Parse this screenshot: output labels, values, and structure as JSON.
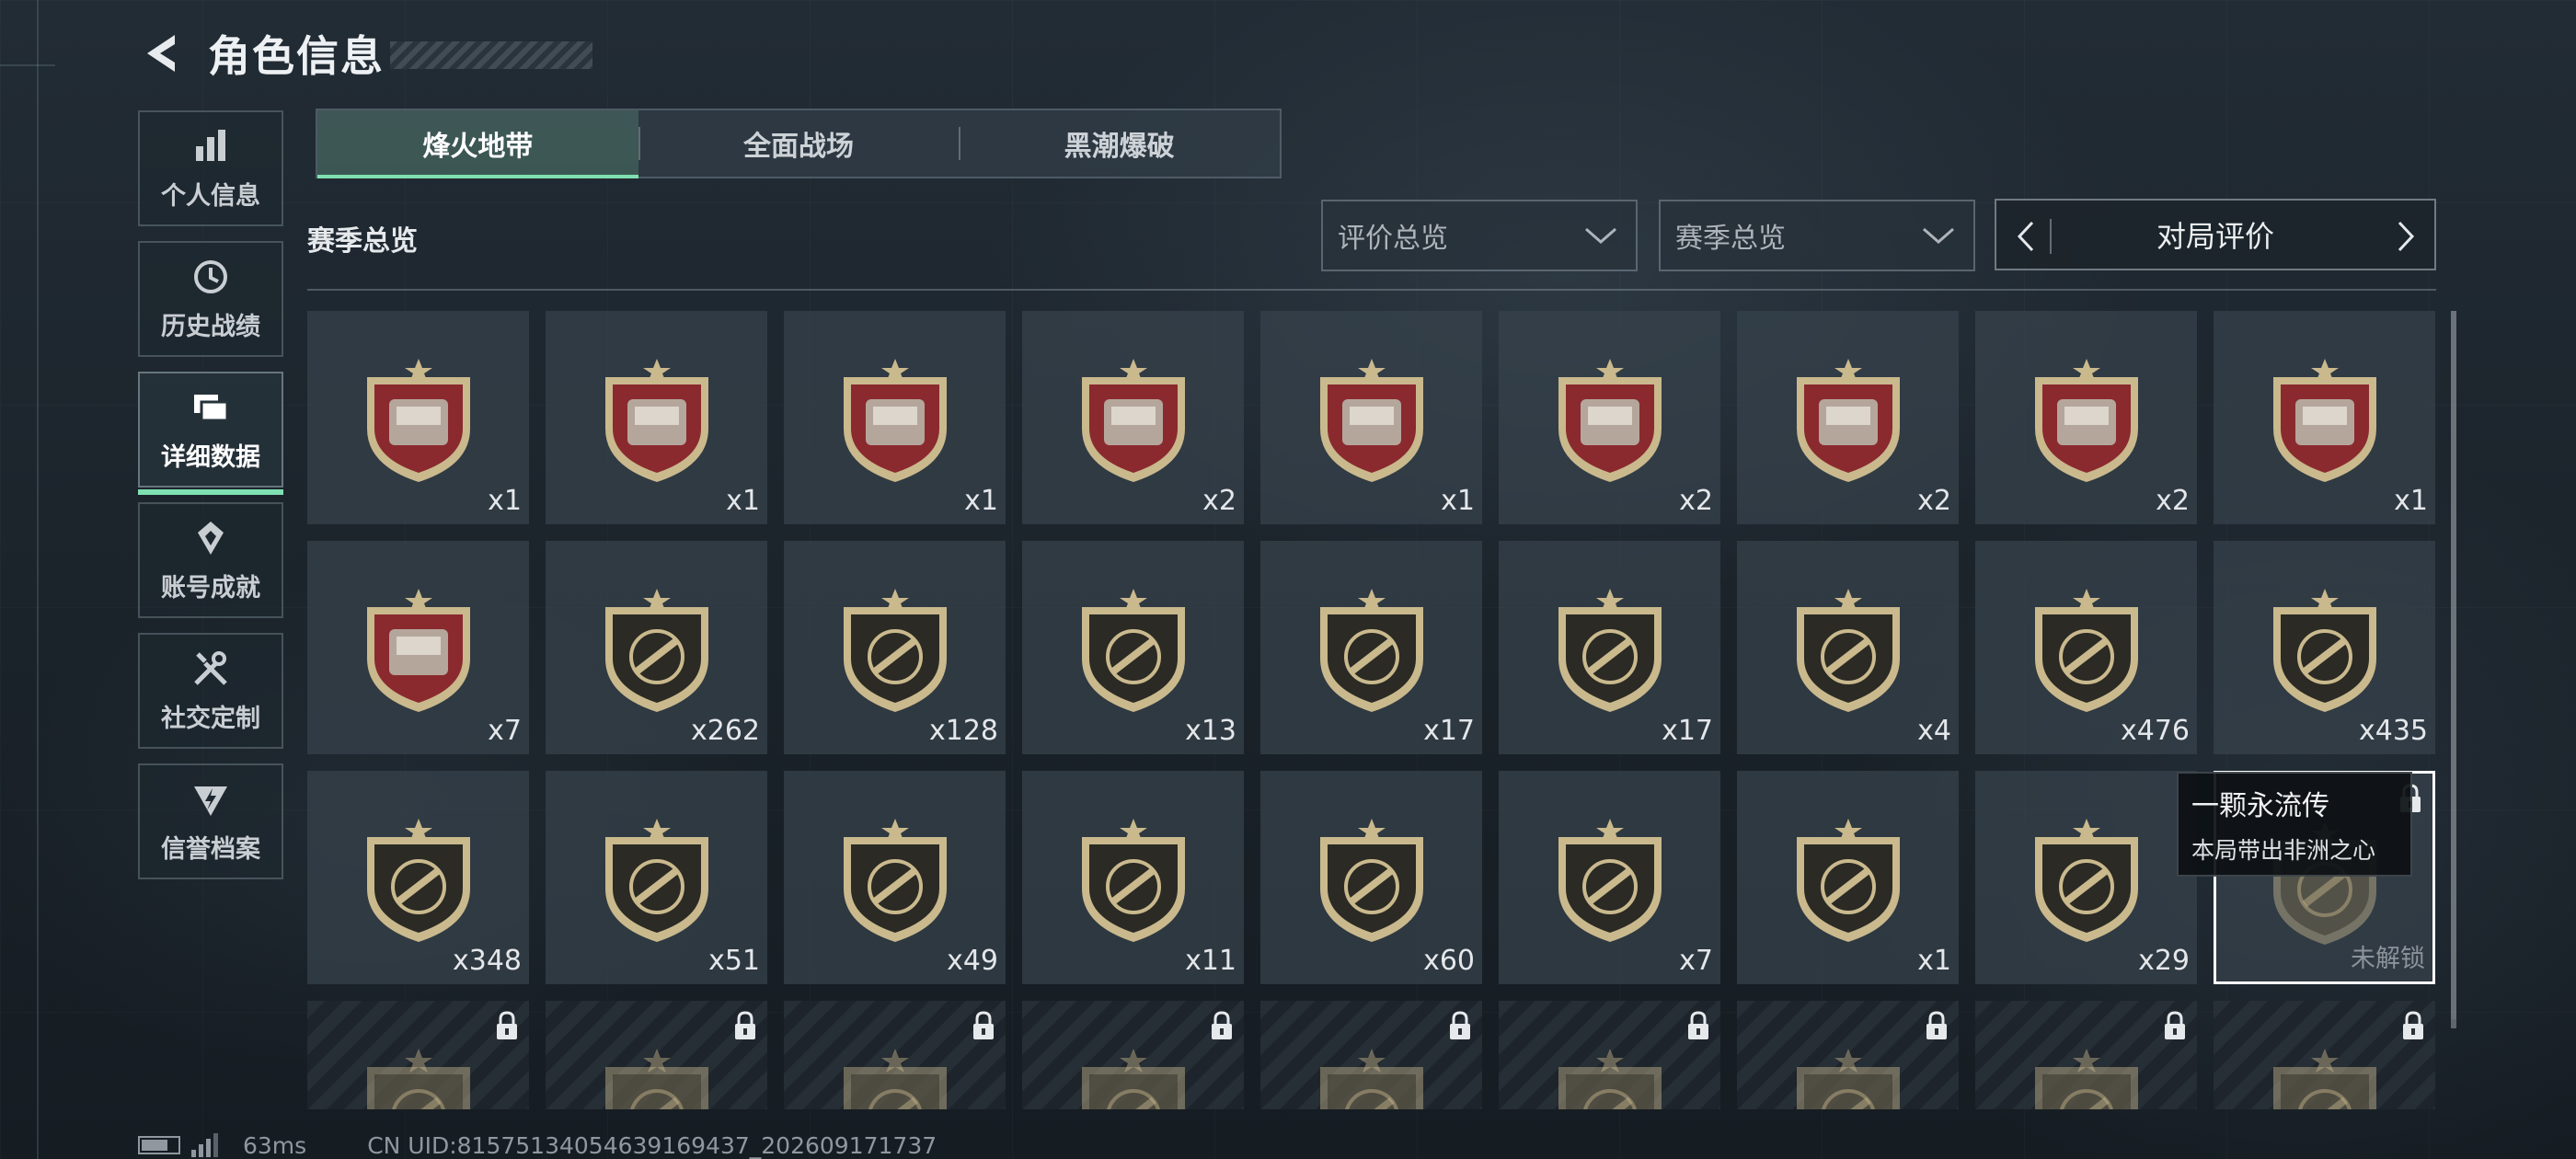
{
  "header": {
    "title": "角色信息"
  },
  "sidebar": {
    "items": [
      {
        "label": "个人信息",
        "icon": "bar-chart-icon",
        "active": false
      },
      {
        "label": "历史战绩",
        "icon": "clock-history-icon",
        "active": false
      },
      {
        "label": "详细数据",
        "icon": "cards-icon",
        "active": true
      },
      {
        "label": "账号成就",
        "icon": "achievement-icon",
        "active": false
      },
      {
        "label": "社交定制",
        "icon": "tools-icon",
        "active": false
      },
      {
        "label": "信誉档案",
        "icon": "shield-bolt-icon",
        "active": false
      }
    ]
  },
  "tabs": [
    {
      "label": "烽火地带",
      "active": true
    },
    {
      "label": "全面战场",
      "active": false
    },
    {
      "label": "黑潮爆破",
      "active": false
    }
  ],
  "section": {
    "title": "赛季总览",
    "dropdown1": "评价总览",
    "dropdown2": "赛季总览",
    "rating_selector": "对局评价"
  },
  "colors": {
    "accent": "#7fe0b1",
    "badge_red": "#8a2a2e",
    "badge_dark": "#2b2a24",
    "badge_gold": "#c9b98d"
  },
  "badges": [
    {
      "count": "x1",
      "style": "red",
      "icon": "tank-icon"
    },
    {
      "count": "x1",
      "style": "red",
      "icon": "medical-station-icon"
    },
    {
      "count": "x1",
      "style": "red",
      "icon": "server-panel-icon"
    },
    {
      "count": "x2",
      "style": "red",
      "icon": "metal-plate-icon"
    },
    {
      "count": "x1",
      "style": "red",
      "icon": "battery-pack-icon"
    },
    {
      "count": "x2",
      "style": "red",
      "icon": "circuit-board-icon"
    },
    {
      "count": "x2",
      "style": "red",
      "icon": "coffee-machine-icon"
    },
    {
      "count": "x2",
      "style": "red",
      "icon": "jeweled-egg-icon"
    },
    {
      "count": "x1",
      "style": "red",
      "icon": "framed-painting-icon"
    },
    {
      "count": "x7",
      "style": "red",
      "icon": "fish-icon"
    },
    {
      "count": "x262",
      "style": "dark",
      "icon": "assault-rifle-icon"
    },
    {
      "count": "x128",
      "style": "dark",
      "icon": "smg-icon"
    },
    {
      "count": "x13",
      "style": "dark",
      "icon": "shotgun-icon"
    },
    {
      "count": "x17",
      "style": "dark",
      "icon": "carbine-icon"
    },
    {
      "count": "x17",
      "style": "dark",
      "icon": "marksman-rifle-icon"
    },
    {
      "count": "x4",
      "style": "dark",
      "icon": "sniper-rifle-icon"
    },
    {
      "count": "x476",
      "style": "dark",
      "icon": "knife-icon"
    },
    {
      "count": "x435",
      "style": "dark",
      "icon": "explosion-icon"
    },
    {
      "count": "x348",
      "style": "dark",
      "icon": "laurel-emblem-icon"
    },
    {
      "count": "x51",
      "style": "dark",
      "icon": "crest-emblem-icon"
    },
    {
      "count": "x49",
      "style": "dark",
      "icon": "fisherman-icon"
    },
    {
      "count": "x11",
      "style": "dark",
      "icon": "beret-operator-icon"
    },
    {
      "count": "x60",
      "style": "dark",
      "icon": "hooded-operator-icon"
    },
    {
      "count": "x7",
      "style": "dark",
      "icon": "operator-portrait-icon"
    },
    {
      "count": "x1",
      "style": "dark",
      "icon": "masked-operator-icon"
    },
    {
      "count": "x29",
      "style": "dark",
      "icon": "bald-operator-icon"
    },
    {
      "count": "",
      "style": "selected-locked",
      "icon": "heart-of-africa-icon",
      "unlock_label": "未解锁"
    },
    {
      "count": "",
      "style": "locked",
      "icon": "helmet-icon"
    },
    {
      "count": "",
      "style": "locked",
      "icon": "reactor-icon"
    },
    {
      "count": "",
      "style": "locked",
      "icon": "chessboard-icon"
    },
    {
      "count": "",
      "style": "locked",
      "icon": "toolbox-icon"
    },
    {
      "count": "",
      "style": "locked",
      "icon": "generator-icon"
    },
    {
      "count": "",
      "style": "locked",
      "icon": "ore-icon"
    },
    {
      "count": "",
      "style": "locked",
      "icon": "weapon-dark-icon"
    },
    {
      "count": "",
      "style": "locked",
      "icon": "operator-dark-icon"
    },
    {
      "count": "",
      "style": "locked",
      "icon": "operator-dark-icon"
    }
  ],
  "tooltip": {
    "title": "一颗永流传",
    "desc": "本局带出非洲之心"
  },
  "status": {
    "ping": "63ms",
    "uid": "CN UID:815751340546391694​37_202609171737"
  }
}
